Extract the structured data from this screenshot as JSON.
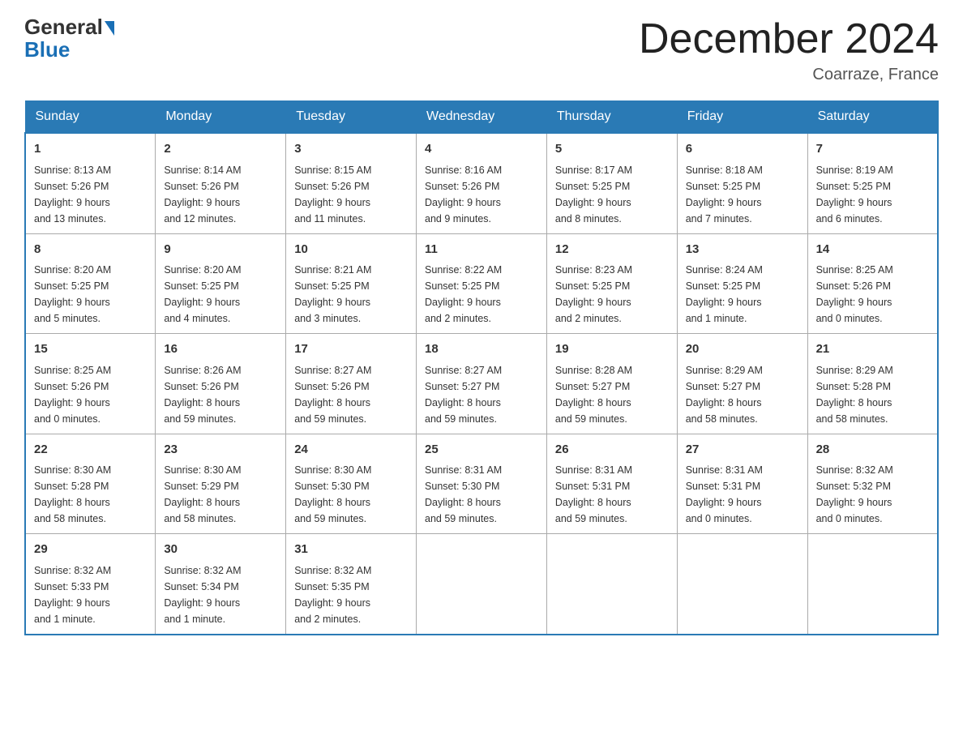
{
  "header": {
    "logo_general": "General",
    "logo_blue": "Blue",
    "month_title": "December 2024",
    "location": "Coarraze, France"
  },
  "days_of_week": [
    "Sunday",
    "Monday",
    "Tuesday",
    "Wednesday",
    "Thursday",
    "Friday",
    "Saturday"
  ],
  "weeks": [
    [
      {
        "day": "1",
        "sunrise": "8:13 AM",
        "sunset": "5:26 PM",
        "daylight": "9 hours and 13 minutes."
      },
      {
        "day": "2",
        "sunrise": "8:14 AM",
        "sunset": "5:26 PM",
        "daylight": "9 hours and 12 minutes."
      },
      {
        "day": "3",
        "sunrise": "8:15 AM",
        "sunset": "5:26 PM",
        "daylight": "9 hours and 11 minutes."
      },
      {
        "day": "4",
        "sunrise": "8:16 AM",
        "sunset": "5:26 PM",
        "daylight": "9 hours and 9 minutes."
      },
      {
        "day": "5",
        "sunrise": "8:17 AM",
        "sunset": "5:25 PM",
        "daylight": "9 hours and 8 minutes."
      },
      {
        "day": "6",
        "sunrise": "8:18 AM",
        "sunset": "5:25 PM",
        "daylight": "9 hours and 7 minutes."
      },
      {
        "day": "7",
        "sunrise": "8:19 AM",
        "sunset": "5:25 PM",
        "daylight": "9 hours and 6 minutes."
      }
    ],
    [
      {
        "day": "8",
        "sunrise": "8:20 AM",
        "sunset": "5:25 PM",
        "daylight": "9 hours and 5 minutes."
      },
      {
        "day": "9",
        "sunrise": "8:20 AM",
        "sunset": "5:25 PM",
        "daylight": "9 hours and 4 minutes."
      },
      {
        "day": "10",
        "sunrise": "8:21 AM",
        "sunset": "5:25 PM",
        "daylight": "9 hours and 3 minutes."
      },
      {
        "day": "11",
        "sunrise": "8:22 AM",
        "sunset": "5:25 PM",
        "daylight": "9 hours and 2 minutes."
      },
      {
        "day": "12",
        "sunrise": "8:23 AM",
        "sunset": "5:25 PM",
        "daylight": "9 hours and 2 minutes."
      },
      {
        "day": "13",
        "sunrise": "8:24 AM",
        "sunset": "5:25 PM",
        "daylight": "9 hours and 1 minute."
      },
      {
        "day": "14",
        "sunrise": "8:25 AM",
        "sunset": "5:26 PM",
        "daylight": "9 hours and 0 minutes."
      }
    ],
    [
      {
        "day": "15",
        "sunrise": "8:25 AM",
        "sunset": "5:26 PM",
        "daylight": "9 hours and 0 minutes."
      },
      {
        "day": "16",
        "sunrise": "8:26 AM",
        "sunset": "5:26 PM",
        "daylight": "8 hours and 59 minutes."
      },
      {
        "day": "17",
        "sunrise": "8:27 AM",
        "sunset": "5:26 PM",
        "daylight": "8 hours and 59 minutes."
      },
      {
        "day": "18",
        "sunrise": "8:27 AM",
        "sunset": "5:27 PM",
        "daylight": "8 hours and 59 minutes."
      },
      {
        "day": "19",
        "sunrise": "8:28 AM",
        "sunset": "5:27 PM",
        "daylight": "8 hours and 59 minutes."
      },
      {
        "day": "20",
        "sunrise": "8:29 AM",
        "sunset": "5:27 PM",
        "daylight": "8 hours and 58 minutes."
      },
      {
        "day": "21",
        "sunrise": "8:29 AM",
        "sunset": "5:28 PM",
        "daylight": "8 hours and 58 minutes."
      }
    ],
    [
      {
        "day": "22",
        "sunrise": "8:30 AM",
        "sunset": "5:28 PM",
        "daylight": "8 hours and 58 minutes."
      },
      {
        "day": "23",
        "sunrise": "8:30 AM",
        "sunset": "5:29 PM",
        "daylight": "8 hours and 58 minutes."
      },
      {
        "day": "24",
        "sunrise": "8:30 AM",
        "sunset": "5:30 PM",
        "daylight": "8 hours and 59 minutes."
      },
      {
        "day": "25",
        "sunrise": "8:31 AM",
        "sunset": "5:30 PM",
        "daylight": "8 hours and 59 minutes."
      },
      {
        "day": "26",
        "sunrise": "8:31 AM",
        "sunset": "5:31 PM",
        "daylight": "8 hours and 59 minutes."
      },
      {
        "day": "27",
        "sunrise": "8:31 AM",
        "sunset": "5:31 PM",
        "daylight": "9 hours and 0 minutes."
      },
      {
        "day": "28",
        "sunrise": "8:32 AM",
        "sunset": "5:32 PM",
        "daylight": "9 hours and 0 minutes."
      }
    ],
    [
      {
        "day": "29",
        "sunrise": "8:32 AM",
        "sunset": "5:33 PM",
        "daylight": "9 hours and 1 minute."
      },
      {
        "day": "30",
        "sunrise": "8:32 AM",
        "sunset": "5:34 PM",
        "daylight": "9 hours and 1 minute."
      },
      {
        "day": "31",
        "sunrise": "8:32 AM",
        "sunset": "5:35 PM",
        "daylight": "9 hours and 2 minutes."
      },
      null,
      null,
      null,
      null
    ]
  ],
  "labels": {
    "sunrise": "Sunrise:",
    "sunset": "Sunset:",
    "daylight": "Daylight:"
  }
}
